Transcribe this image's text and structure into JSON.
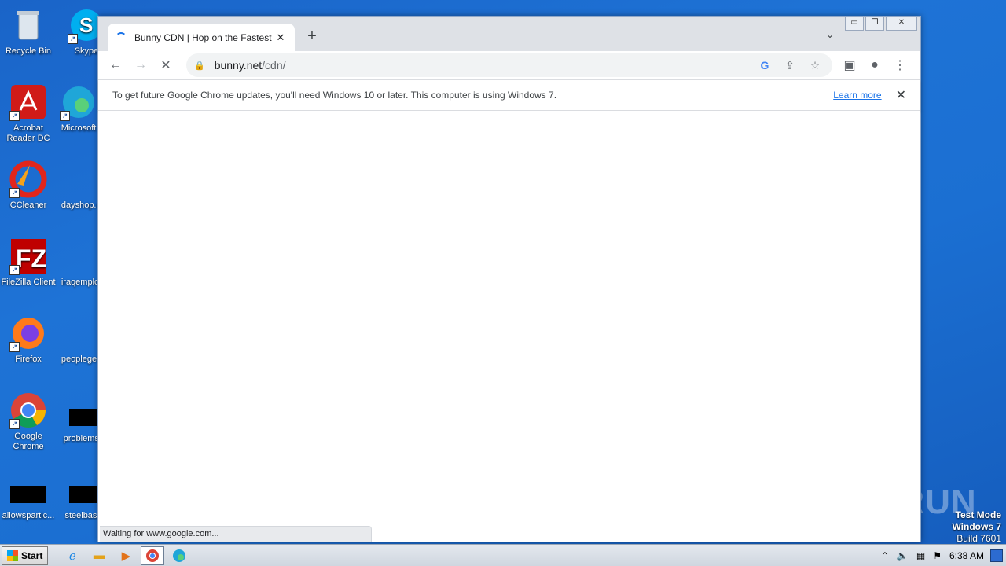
{
  "desktop": {
    "icons": [
      {
        "label": "Recycle Bin"
      },
      {
        "label": "Skype"
      },
      {
        "label": "Acrobat Reader DC"
      },
      {
        "label": "Microsoft"
      },
      {
        "label": "CCleaner"
      },
      {
        "label": "dayshop.r"
      },
      {
        "label": "FileZilla Client"
      },
      {
        "label": "iraqemplo"
      },
      {
        "label": "Firefox"
      },
      {
        "label": "peopleget"
      },
      {
        "label": "Google Chrome"
      },
      {
        "label": "problemsc"
      },
      {
        "label": "allowspartic..."
      },
      {
        "label": "steelbase"
      }
    ],
    "watermark": "ANY RUN",
    "test_mode": {
      "line1": "Test Mode",
      "line2": "Windows 7",
      "line3": "Build 7601"
    }
  },
  "browser": {
    "tab": {
      "title": "Bunny CDN | Hop on the Fastest Co",
      "close": "✕"
    },
    "new_tab": "+",
    "tab_menu": "⌄",
    "window_controls": {
      "minimize": "▭",
      "restore": "❐",
      "close": "✕"
    },
    "toolbar": {
      "back": "←",
      "forward": "→",
      "stop": "✕",
      "sidepanel": "▣",
      "menu": "⋮"
    },
    "omnibox": {
      "host": "bunny.net",
      "path": "/cdn/",
      "google_icon": "G",
      "share": "⇪",
      "bookmark": "☆",
      "profile": "●"
    },
    "infobar": {
      "message": "To get future Google Chrome updates, you'll need Windows 10 or later. This computer is using Windows 7.",
      "link": "Learn more",
      "close": "✕"
    },
    "status": "Waiting for www.google.com..."
  },
  "taskbar": {
    "start": "Start",
    "clock": "6:38 AM"
  }
}
